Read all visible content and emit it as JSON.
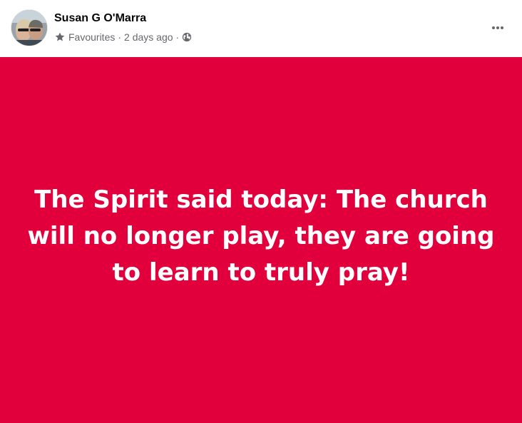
{
  "post": {
    "author_name": "Susan G O'Marra",
    "audience": "Favourites",
    "separator": "·",
    "timestamp": "2 days ago",
    "privacy_icon": "globe-icon",
    "favourite_icon": "star-icon",
    "menu_icon": "more-horizontal-icon",
    "body_text": "The Spirit said today: The church will no longer play, they are going to learn to truly pray!",
    "background_color": "#e1003c",
    "text_color": "#ffffff"
  }
}
